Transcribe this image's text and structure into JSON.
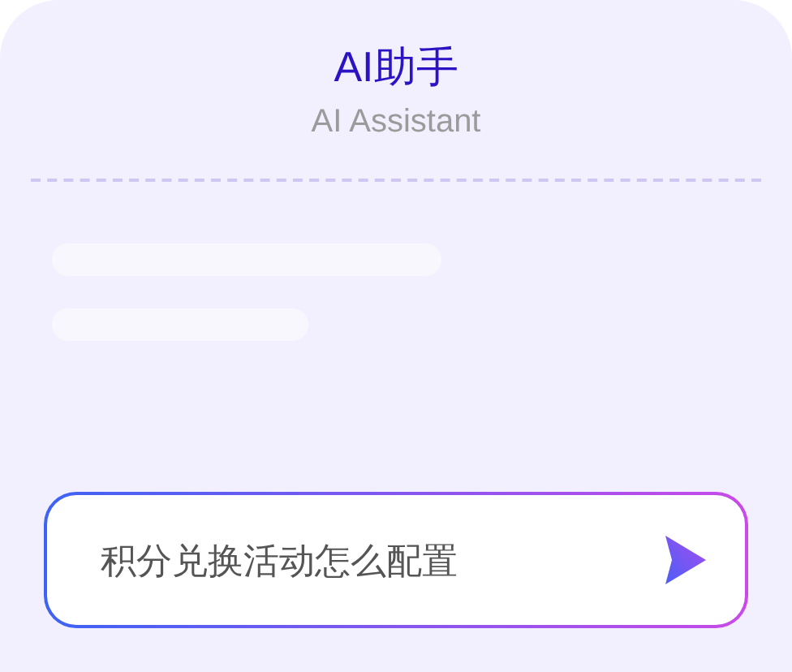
{
  "header": {
    "title": "AI助手",
    "subtitle": "AI Assistant"
  },
  "loading": true,
  "input": {
    "value": "积分兑换活动怎么配置"
  }
}
